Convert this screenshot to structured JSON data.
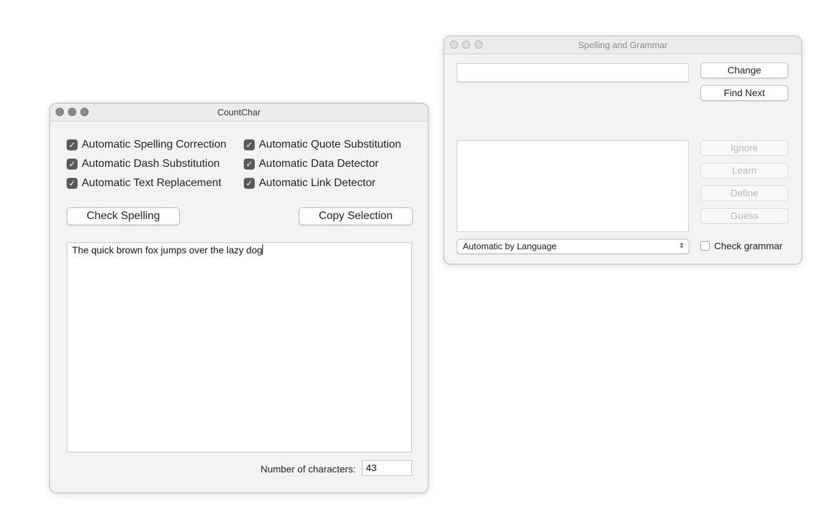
{
  "countchar": {
    "title": "CountChar",
    "checkboxes": [
      {
        "label": "Automatic Spelling Correction",
        "checked": true
      },
      {
        "label": "Automatic Quote Substitution",
        "checked": true
      },
      {
        "label": "Automatic Dash Substitution",
        "checked": true
      },
      {
        "label": "Automatic Data Detector",
        "checked": true
      },
      {
        "label": "Automatic Text Replacement",
        "checked": true
      },
      {
        "label": "Automatic Link Detector",
        "checked": true
      }
    ],
    "check_spelling_label": "Check Spelling",
    "copy_selection_label": "Copy Selection",
    "text": "The quick brown fox jumps over the lazy dog",
    "count_label": "Number of characters:",
    "count_value": "43"
  },
  "spelling": {
    "title": "Spelling and Grammar",
    "change_label": "Change",
    "find_next_label": "Find Next",
    "ignore_label": "Ignore",
    "learn_label": "Learn",
    "define_label": "Define",
    "guess_label": "Guess",
    "language_value": "Automatic by Language",
    "check_grammar_label": "Check grammar"
  },
  "icons": {
    "checkmark": "check-icon",
    "select_arrows": "up-down-chevron-icon"
  }
}
